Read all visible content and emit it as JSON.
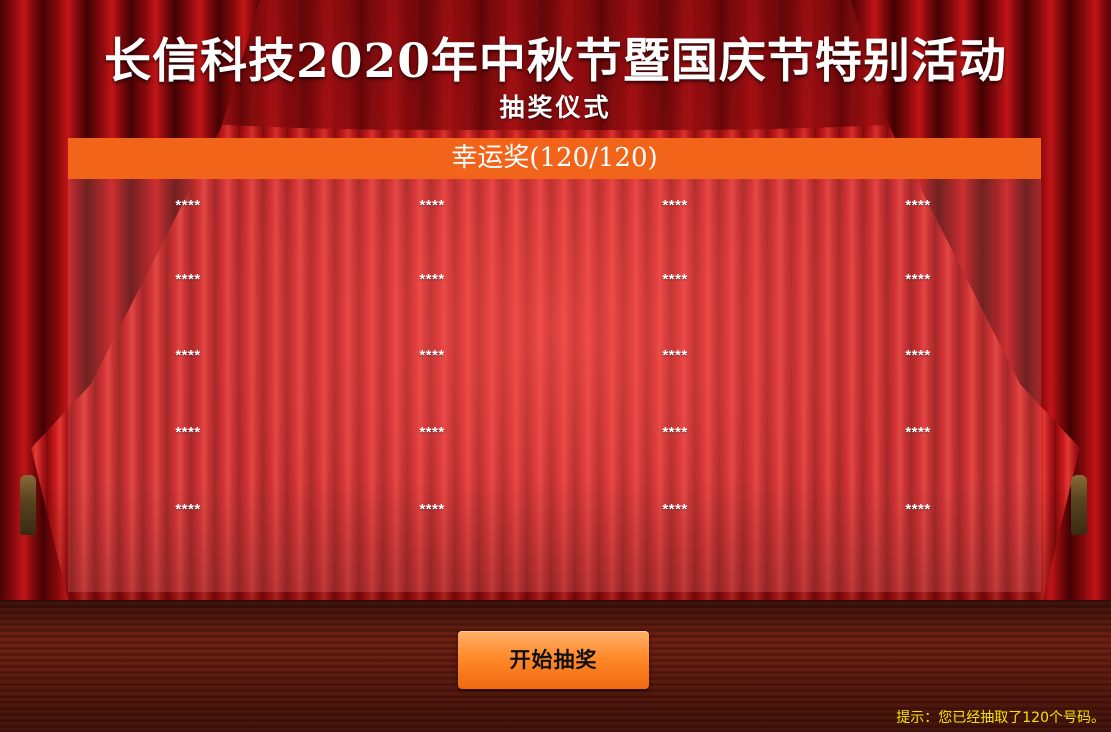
{
  "title": "长信科技2020年中秋节暨国庆节特别活动",
  "subtitle": "抽奖仪式",
  "prize": {
    "header": "幸运奖(120/120)"
  },
  "winners": {
    "rows": [
      [
        "****",
        "****",
        "****",
        "****"
      ],
      [
        "****",
        "****",
        "****",
        "****"
      ],
      [
        "****",
        "****",
        "****",
        "****"
      ],
      [
        "****",
        "****",
        "****",
        "****"
      ],
      [
        "****",
        "****",
        "****",
        "****"
      ]
    ]
  },
  "start_button": {
    "label": "开始抽奖"
  },
  "hint": "提示：您已经抽取了120个号码。",
  "colors": {
    "header_bg": "#f2641a",
    "button": "#ff8a2a",
    "hint_text": "#f4e600",
    "curtain": "#c81a1c"
  },
  "icons": {
    "curtain": "stage-curtain",
    "tassel": "curtain-tassel"
  }
}
